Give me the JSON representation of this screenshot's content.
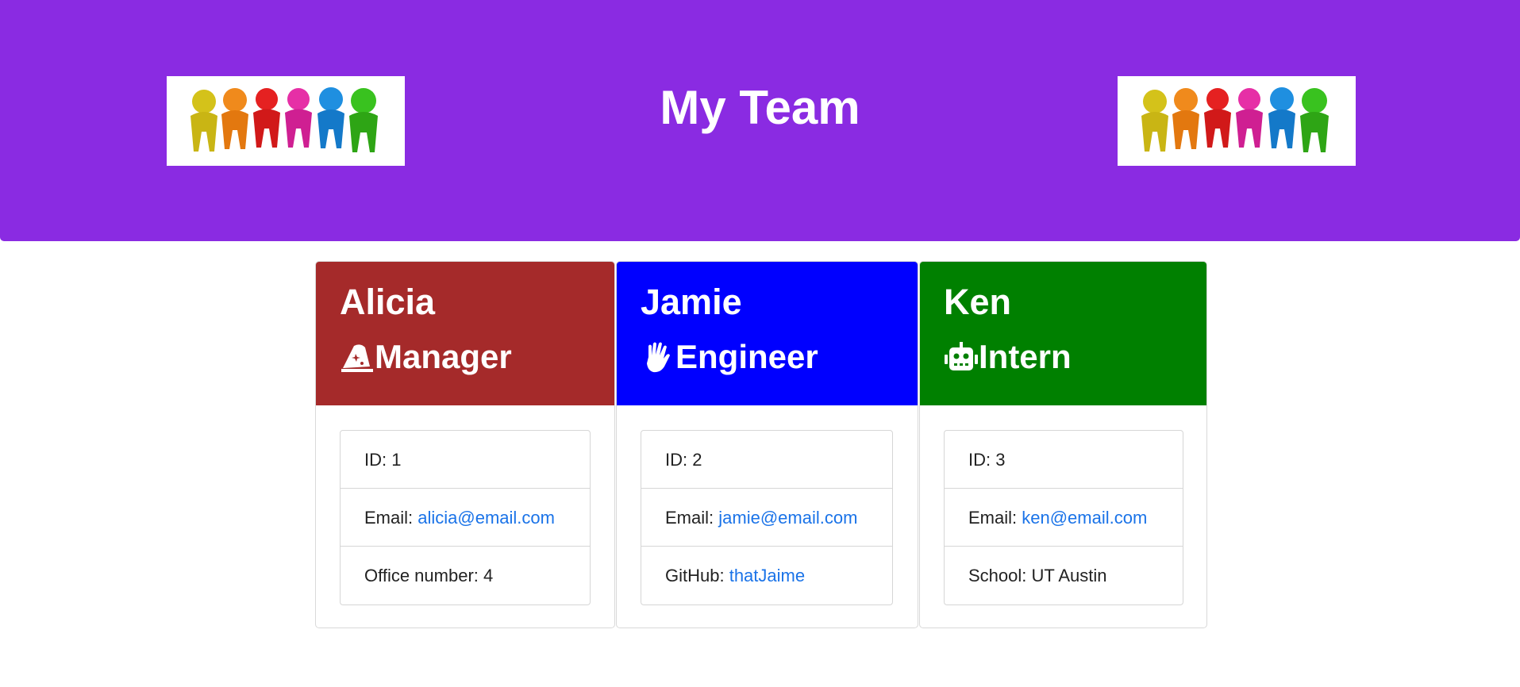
{
  "header": {
    "title": "My Team",
    "background_color": "#8a2be2",
    "left_image": "team-people-image",
    "right_image": "team-people-image"
  },
  "cards": [
    {
      "name": "Alicia",
      "role": "Manager",
      "role_icon": "wizard-hat-icon",
      "header_color": "#a52a2a",
      "id_label": "ID: ",
      "id_value": "1",
      "email_label": "Email: ",
      "email": "alicia@email.com",
      "extra_label": "Office number: ",
      "extra_value": "4"
    },
    {
      "name": "Jamie",
      "role": "Engineer",
      "role_icon": "hand-wave-icon",
      "header_color": "#0000ff",
      "id_label": "ID: ",
      "id_value": "2",
      "email_label": "Email: ",
      "email": "jamie@email.com",
      "extra_label": "GitHub: ",
      "extra_value": "thatJaime"
    },
    {
      "name": "Ken",
      "role": "Intern",
      "role_icon": "robot-icon",
      "header_color": "#008000",
      "id_label": "ID: ",
      "id_value": "3",
      "email_label": "Email: ",
      "email": "ken@email.com",
      "extra_label": "School: ",
      "extra_value": "UT Austin"
    }
  ],
  "link_color": "#1a73e8"
}
